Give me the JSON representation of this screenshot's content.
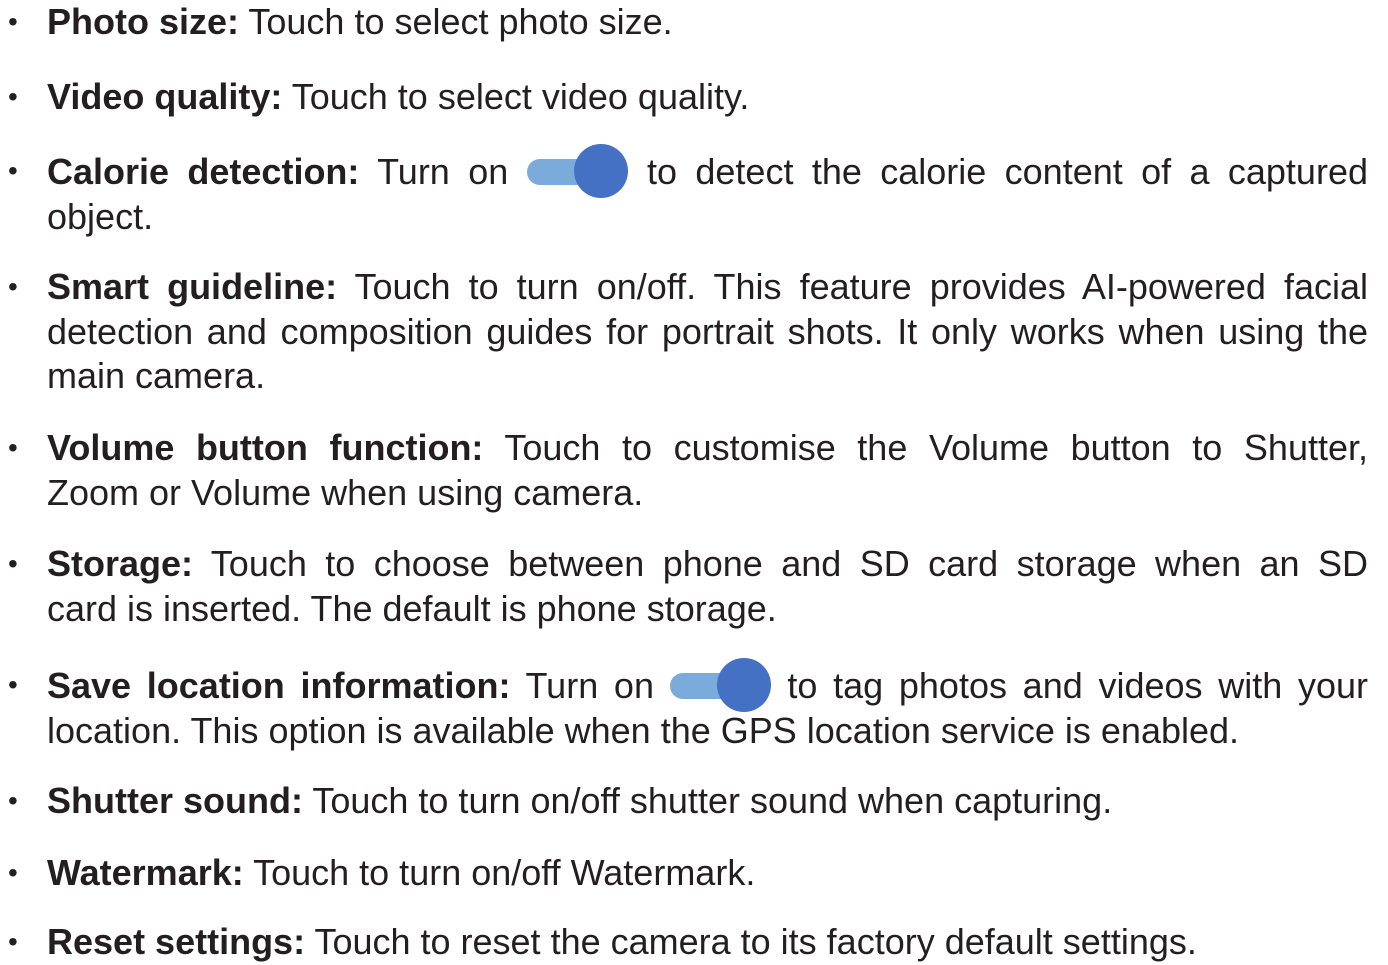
{
  "items": [
    {
      "term": "Photo size:",
      "text": "Touch to select photo size."
    },
    {
      "term": "Video quality:",
      "text": "Touch to select video quality."
    },
    {
      "term": "Calorie detection:",
      "before": "Turn on",
      "after": "to detect the calorie content of a captured",
      "line2": "object.",
      "toggle": "on"
    },
    {
      "term": "Smart guideline:",
      "line1": "Touch to turn on/off. This feature provides AI-powered facial",
      "line2": "detection and composition guides for portrait shots. It only works when using the",
      "line3": "main camera."
    },
    {
      "term": "Volume button function:",
      "line1": "Touch to customise the Volume button to Shutter,",
      "line2": "Zoom or Volume when using camera."
    },
    {
      "term": "Storage:",
      "line1": "Touch to choose between phone and SD card storage when an SD",
      "line2": "card is inserted. The default is phone storage."
    },
    {
      "term": "Save location information:",
      "before": "Turn on",
      "after": "to tag photos and videos with your",
      "line2": "location. This option is available when the GPS location service is enabled.",
      "toggle": "on"
    },
    {
      "term": "Shutter sound:",
      "text": "Touch to turn on/off shutter sound when capturing."
    },
    {
      "term": "Watermark:",
      "text": "Touch to turn on/off Watermark."
    },
    {
      "term": "Reset settings:",
      "text": "Touch to reset the camera to its factory default settings."
    }
  ],
  "colors": {
    "text": "#231f20",
    "toggle_track": "#7aabdb",
    "toggle_knob": "#4471c4"
  },
  "bullet": "•"
}
